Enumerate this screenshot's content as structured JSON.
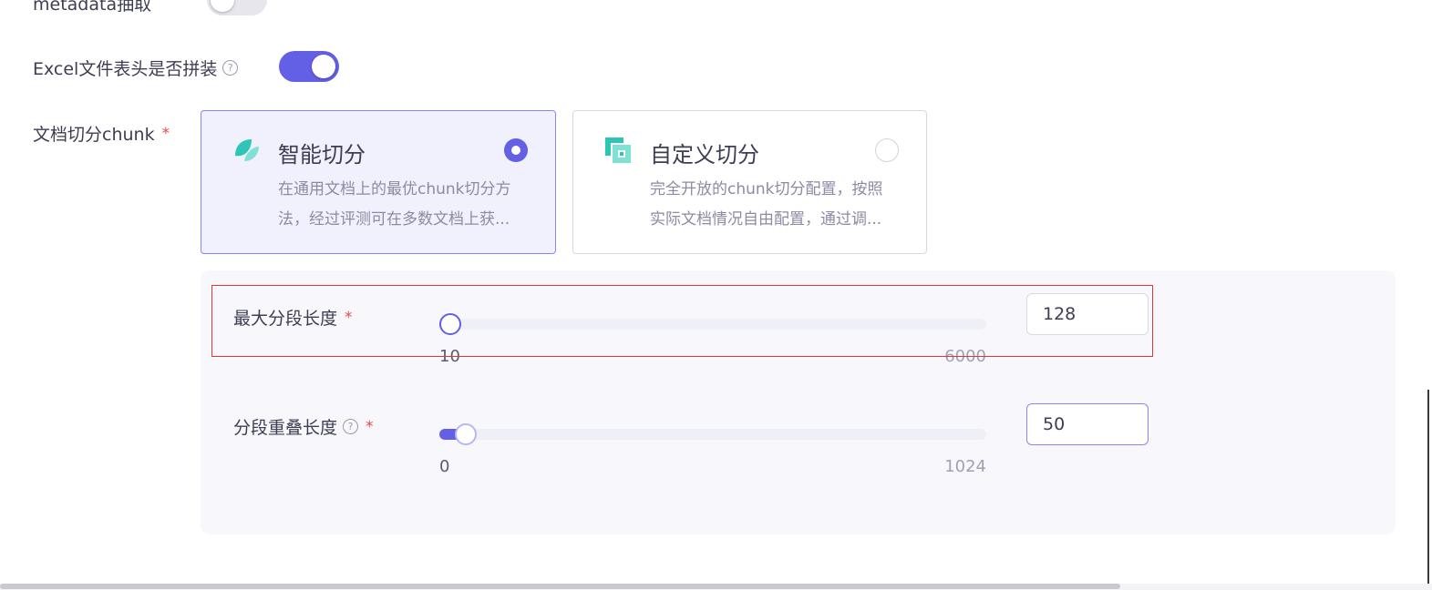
{
  "form": {
    "metadata_row": {
      "label": "metadata抽取",
      "toggle_state": "off"
    },
    "excel_row": {
      "label": "Excel文件表头是否拼装",
      "help_glyph": "?",
      "toggle_state": "on"
    },
    "chunk_row": {
      "label": "文档切分chunk",
      "required_mark": "*",
      "options": [
        {
          "title": "智能切分",
          "desc_line1": "在通用文档上的最优chunk切分方",
          "desc_line2": "法，经过评测可在多数文档上获...",
          "selected": true,
          "icon": "smart-split-icon"
        },
        {
          "title": "自定义切分",
          "desc_line1": "完全开放的chunk切分配置，按照",
          "desc_line2": "实际文档情况自由配置，通过调...",
          "selected": false,
          "icon": "custom-split-icon"
        }
      ]
    },
    "max_segment": {
      "label": "最大分段长度",
      "required_mark": "*",
      "min": "10",
      "max": "6000",
      "value": "128"
    },
    "overlap": {
      "label": "分段重叠长度",
      "help_glyph": "?",
      "required_mark": "*",
      "min": "0",
      "max": "1024",
      "value": "50"
    }
  },
  "colors": {
    "accent": "#6360e5",
    "selected_card_bg": "#f1f0fd",
    "panel_bg": "#f8f8fc",
    "highlight": "#e0373d",
    "icon_teal": "#2ec4b6"
  }
}
